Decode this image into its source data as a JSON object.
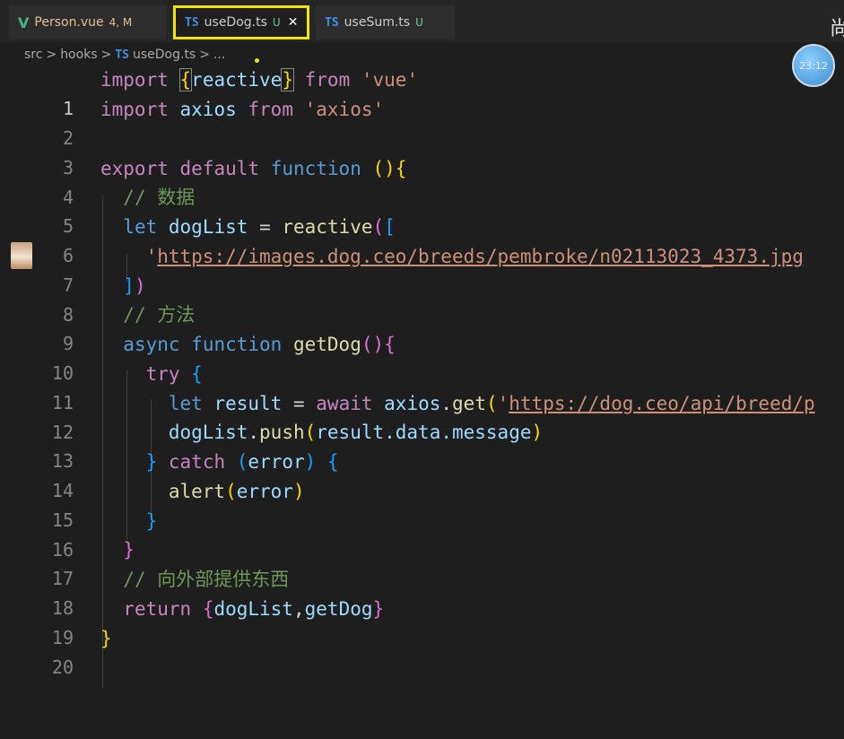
{
  "tabs": [
    {
      "icon": "V",
      "name": "Person.vue",
      "badge": "4, M"
    },
    {
      "icon": "TS",
      "name": "useDog.ts",
      "badge": "U",
      "close": "✕"
    },
    {
      "icon": "TS",
      "name": "useSum.ts",
      "badge": "U"
    }
  ],
  "corner_glyph": "尚",
  "timer_text": "23:12",
  "breadcrumb": {
    "src": "src",
    "sep": ">",
    "hooks": "hooks",
    "icon": "TS",
    "file": "useDog.ts",
    "more": "..."
  },
  "line_numbers": [
    "1",
    "2",
    "3",
    "4",
    "5",
    "6",
    "7",
    "8",
    "9",
    "10",
    "11",
    "12",
    "13",
    "14",
    "15",
    "16",
    "17",
    "18",
    "19",
    "20"
  ],
  "code": {
    "l1": {
      "import": "import",
      "ob": "{",
      "reactive": "reactive",
      "cb": "}",
      "from": "from",
      "mod": "'vue'"
    },
    "l2": {
      "import": "import",
      "axios": "axios",
      "from": "from",
      "mod": "'axios'"
    },
    "l4": {
      "export": "export",
      "default": "default",
      "function": "function",
      "paren": "()",
      "ob": "{"
    },
    "l5": {
      "comment": "// 数据"
    },
    "l6": {
      "let": "let",
      "name": "dogList",
      "eq": "=",
      "fn": "reactive",
      "op": "(",
      "ob": "["
    },
    "l7": {
      "q": "'",
      "url": "https://images.dog.ceo/breeds/pembroke/n02113023_4373.jpg"
    },
    "l8": {
      "cb": "]",
      "cp": ")"
    },
    "l9": {
      "comment": "// 方法"
    },
    "l10": {
      "async": "async",
      "function": "function",
      "name": "getDog",
      "paren": "()",
      "ob": "{"
    },
    "l11": {
      "try": "try",
      "ob": "{"
    },
    "l12": {
      "let": "let",
      "name": "result",
      "eq": "=",
      "await": "await",
      "obj": "axios",
      "dot": ".",
      "fn": "get",
      "op": "(",
      "q": "'",
      "url": "https://dog.ceo/api/breed/p"
    },
    "l13": {
      "obj": "dogList",
      "dot": ".",
      "fn": "push",
      "op": "(",
      "arg": "result.data.message",
      "cp": ")"
    },
    "l14": {
      "cb": "}",
      "catch": "catch",
      "op": "(",
      "arg": "error",
      "cp": ")",
      "ob": "{"
    },
    "l15": {
      "fn": "alert",
      "op": "(",
      "arg": "error",
      "cp": ")"
    },
    "l16": {
      "cb": "}"
    },
    "l17": {
      "cb": "}"
    },
    "l18": {
      "comment": "// 向外部提供东西"
    },
    "l19": {
      "ret": "return",
      "ob": "{",
      "a": "dogList",
      "comma": ",",
      "b": "getDog",
      "cb": "}"
    },
    "l20": {
      "cb": "}"
    }
  }
}
